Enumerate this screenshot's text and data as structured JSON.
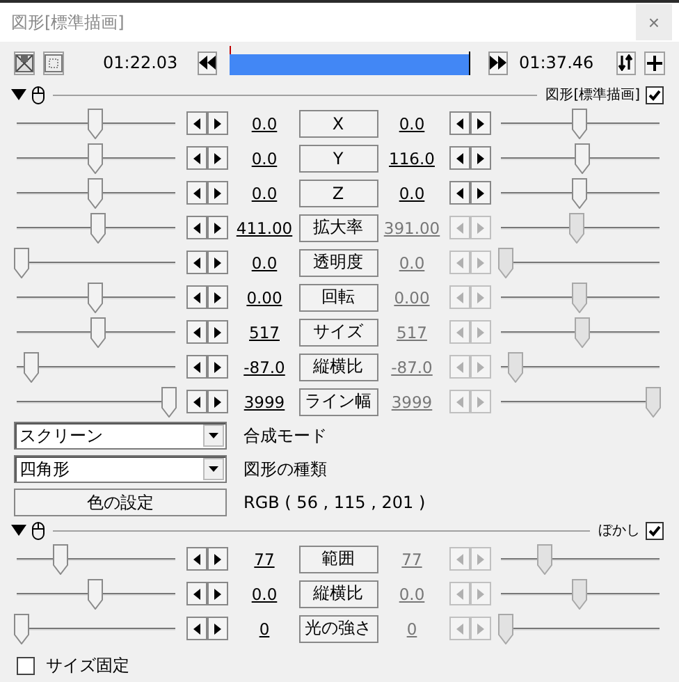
{
  "window": {
    "title": "図形[標準描画]",
    "close": "×"
  },
  "timeline": {
    "start": "01:22.03",
    "end": "01:37.46",
    "level": 0
  },
  "sections": [
    {
      "title": "図形[標準描画]",
      "enabled": true,
      "expanded": true,
      "tracks": [
        {
          "label": "X",
          "start": {
            "value": "0.0",
            "level": 0.5
          },
          "end": {
            "value": "0.0",
            "level": 0.5,
            "enabled": true
          }
        },
        {
          "label": "Y",
          "start": {
            "value": "0.0",
            "level": 0.5
          },
          "end": {
            "value": "116.0",
            "level": 0.52,
            "enabled": true
          }
        },
        {
          "label": "Z",
          "start": {
            "value": "0.0",
            "level": 0.5
          },
          "end": {
            "value": "0.0",
            "level": 0.5,
            "enabled": true
          }
        },
        {
          "label": "拡大率",
          "start": {
            "value": "411.00",
            "level": 0.52
          },
          "end": {
            "value": "391.00",
            "level": 0.48,
            "enabled": false
          }
        },
        {
          "label": "透明度",
          "start": {
            "value": "0.0",
            "level": 0
          },
          "end": {
            "value": "0.0",
            "level": 0,
            "enabled": false
          }
        },
        {
          "label": "回転",
          "start": {
            "value": "0.00",
            "level": 0.5
          },
          "end": {
            "value": "0.00",
            "level": 0.5,
            "enabled": false
          }
        },
        {
          "label": "サイズ",
          "start": {
            "value": "517",
            "level": 0.52
          },
          "end": {
            "value": "517",
            "level": 0.52,
            "enabled": false
          }
        },
        {
          "label": "縦横比",
          "start": {
            "value": "-87.0",
            "level": 0.07
          },
          "end": {
            "value": "-87.0",
            "level": 0.07,
            "enabled": false
          }
        },
        {
          "label": "ライン幅",
          "start": {
            "value": "3999",
            "level": 1
          },
          "end": {
            "value": "3999",
            "level": 1,
            "enabled": false
          }
        }
      ],
      "controls": [
        {
          "kind": "dropdown",
          "value": "スクリーン",
          "label": "合成モード"
        },
        {
          "kind": "dropdown",
          "value": "四角形",
          "label": "図形の種類"
        },
        {
          "kind": "button",
          "text": "色の設定",
          "label": "RGB ( 56 , 115 , 201 )"
        }
      ]
    },
    {
      "title": "ぼかし",
      "enabled": true,
      "expanded": true,
      "tracks": [
        {
          "label": "範囲",
          "start": {
            "value": "77",
            "level": 0.26
          },
          "end": {
            "value": "77",
            "level": 0.26,
            "enabled": false
          }
        },
        {
          "label": "縦横比",
          "start": {
            "value": "0.0",
            "level": 0.5
          },
          "end": {
            "value": "0.0",
            "level": 0.5,
            "enabled": false
          }
        },
        {
          "label": "光の強さ",
          "start": {
            "value": "0",
            "level": 0
          },
          "end": {
            "value": "0",
            "level": 0,
            "enabled": false
          }
        }
      ],
      "controls": [
        {
          "kind": "checkbox",
          "label": "サイズ固定",
          "checked": false
        }
      ]
    }
  ]
}
